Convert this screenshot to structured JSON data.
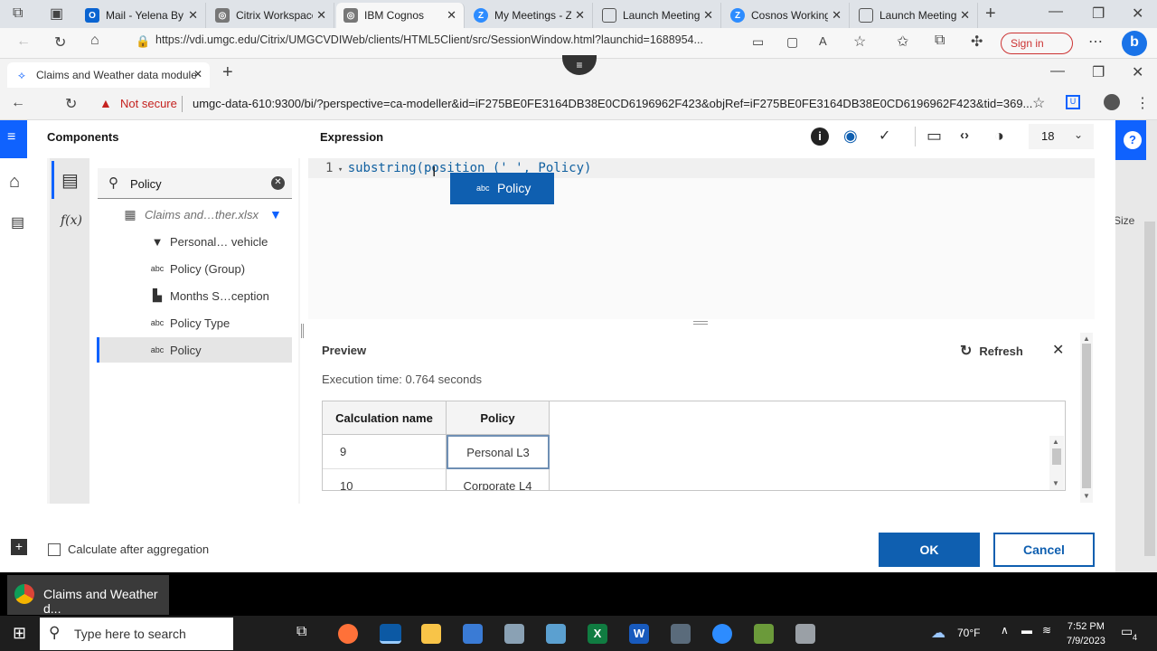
{
  "browser": {
    "tabs": [
      {
        "label": "Mail - Yelena By",
        "color": "#0a64d1",
        "glyph": "O"
      },
      {
        "label": "Citrix Workspace",
        "color": "#666666",
        "glyph": "◎"
      },
      {
        "label": "IBM Cognos",
        "color": "#666666",
        "glyph": "◎"
      },
      {
        "label": "My Meetings - Z",
        "color": "#2d8cff",
        "glyph": "Z"
      },
      {
        "label": "Launch Meeting",
        "color": "#888888",
        "glyph": "▯"
      },
      {
        "label": "Cosnos Working",
        "color": "#2d8cff",
        "glyph": "Z"
      },
      {
        "label": "Launch Meeting",
        "color": "#888888",
        "glyph": "▯"
      }
    ],
    "url": "https://vdi.umgc.edu/Citrix/UMGCVDIWeb/clients/HTML5Client/src/SessionWindow.html?launchid=1688954...",
    "sign_in": "Sign in"
  },
  "citrix": {
    "tab_title": "Claims and Weather data module",
    "not_secure": "Not secure",
    "address": "umgc-data-610:9300/bi/?perspective=ca-modeller&id=iF275BE0FE3164DB38E0CD6196962F423&objRef=iF275BE0FE3164DB38E0CD6196962F423&tid=369...",
    "size_label": "Size"
  },
  "dialog": {
    "components_title": "Components",
    "expression_title": "Expression",
    "font_size": "18",
    "search_value": "Policy",
    "tree_root": "Claims and…ther.xlsx",
    "tree_items": [
      {
        "icon": "▼",
        "label": "Personal… vehicle"
      },
      {
        "icon": "abc",
        "label": "Policy (Group)"
      },
      {
        "icon": "▙",
        "label": "Months S…ception"
      },
      {
        "icon": "abc",
        "label": "Policy Type"
      },
      {
        "icon": "abc",
        "label": "Policy"
      }
    ],
    "fx_label": "f(x)",
    "code_line_no": "1",
    "code_text": "substring(position (' ', Policy)",
    "autocomplete": {
      "icon": "abc",
      "label": "Policy"
    },
    "preview_title": "Preview",
    "refresh_label": "Refresh",
    "execution_time": "Execution time: 0.764 seconds",
    "grid": {
      "headers": [
        "Calculation name",
        "Policy"
      ],
      "rows": [
        [
          "9",
          "Personal L3"
        ],
        [
          "10",
          "Corporate L4"
        ]
      ]
    },
    "calc_after_aggregation": "Calculate after aggregation",
    "ok_label": "OK",
    "cancel_label": "Cancel"
  },
  "citrix_taskbar": {
    "label": "Claims and Weather d..."
  },
  "taskbar": {
    "search_placeholder": "Type here to search",
    "temperature": "70°F",
    "time": "7:52 PM",
    "date": "7/9/2023",
    "notif_count": "4"
  },
  "colors": {
    "accent": "#0f62fe",
    "button_blue": "#0f5fb0"
  }
}
